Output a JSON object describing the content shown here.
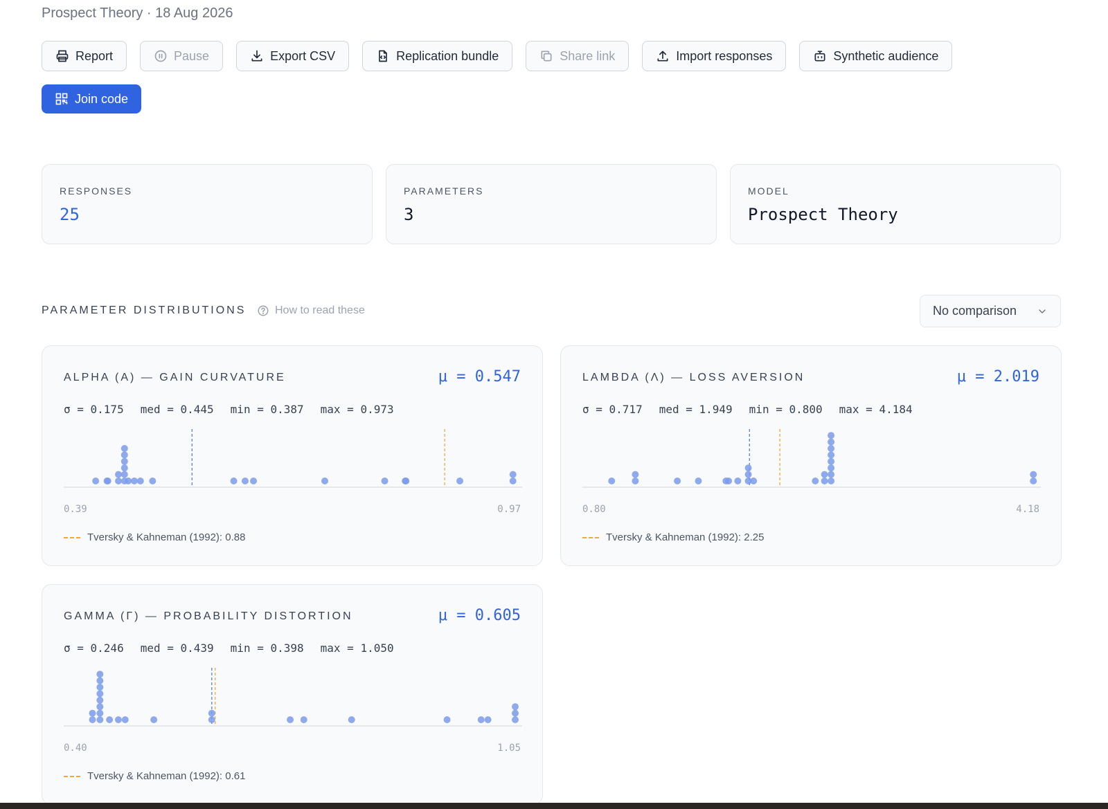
{
  "header": {
    "subtitle": "Prospect Theory · 18 Aug 2026"
  },
  "toolbar": {
    "buttons": [
      {
        "label": "Report",
        "icon": "printer-icon",
        "muted": false
      },
      {
        "label": "Pause",
        "icon": "pause-icon",
        "muted": true
      },
      {
        "label": "Export CSV",
        "icon": "download-icon",
        "muted": false
      },
      {
        "label": "Replication bundle",
        "icon": "file-code-icon",
        "muted": false
      },
      {
        "label": "Share link",
        "icon": "copy-icon",
        "muted": true
      },
      {
        "label": "Import responses",
        "icon": "upload-icon",
        "muted": false
      },
      {
        "label": "Synthetic audience",
        "icon": "bot-icon",
        "muted": false
      }
    ],
    "primary": {
      "label": "Join code",
      "icon": "qr-code-icon"
    }
  },
  "stats": [
    {
      "label": "RESPONSES",
      "value": "25"
    },
    {
      "label": "PARAMETERS",
      "value": "3"
    },
    {
      "label": "MODEL",
      "value": "Prospect Theory"
    }
  ],
  "section": {
    "title": "PARAMETER DISTRIBUTIONS",
    "help": "How to read these",
    "comparison": "No comparison"
  },
  "colors": {
    "accent": "#2f63e0",
    "dot": "#7b9bea",
    "reference": "#f2a93b"
  },
  "chart_data": [
    {
      "type": "scatter",
      "title": "ALPHA (Α) — GAIN CURVATURE",
      "mu_label": "μ = 0.547",
      "sigma": "σ = 0.175",
      "median": "med = 0.445",
      "min": "min = 0.387",
      "max": "max = 0.973",
      "x_min_label": "0.39",
      "x_max_label": "0.97",
      "xlim": [
        0.387,
        0.973
      ],
      "mean": 0.547,
      "reference": 0.88,
      "reference_label": "Tversky & Kahneman (1992): 0.88",
      "values": [
        0.42,
        0.435,
        0.436,
        0.45,
        0.45,
        0.458,
        0.458,
        0.458,
        0.458,
        0.458,
        0.458,
        0.463,
        0.471,
        0.479,
        0.495,
        0.602,
        0.617,
        0.628,
        0.722,
        0.801,
        0.828,
        0.829,
        0.9,
        0.97,
        0.97
      ],
      "chart_type_note": "dot-stacked strip plot"
    },
    {
      "type": "scatter",
      "title": "LAMBDA (Λ) — LOSS AVERSION",
      "mu_label": "μ = 2.019",
      "sigma": "σ = 0.717",
      "median": "med = 1.949",
      "min": "min = 0.800",
      "max": "max = 4.184",
      "x_min_label": "0.80",
      "x_max_label": "4.18",
      "xlim": [
        0.8,
        4.184
      ],
      "mean": 2.019,
      "reference": 2.25,
      "reference_label": "Tversky & Kahneman (1992): 2.25",
      "values": [
        0.97,
        1.15,
        1.15,
        1.47,
        1.63,
        1.84,
        1.86,
        1.93,
        2.01,
        2.01,
        2.01,
        2.05,
        2.52,
        2.59,
        2.59,
        2.64,
        2.64,
        2.64,
        2.64,
        2.64,
        2.64,
        2.64,
        2.64,
        4.18,
        4.18
      ],
      "chart_type_note": "dot-stacked strip plot"
    },
    {
      "type": "scatter",
      "title": "GAMMA (Γ) — PROBABILITY DISTORTION",
      "mu_label": "μ = 0.605",
      "sigma": "σ = 0.246",
      "median": "med = 0.439",
      "min": "min = 0.398",
      "max": "max = 1.050",
      "x_min_label": "0.40",
      "x_max_label": "1.05",
      "xlim": [
        0.398,
        1.05
      ],
      "mean": 0.605,
      "reference": 0.61,
      "reference_label": "Tversky & Kahneman (1992): 0.61",
      "values": [
        0.43,
        0.43,
        0.441,
        0.441,
        0.441,
        0.441,
        0.441,
        0.441,
        0.441,
        0.441,
        0.455,
        0.468,
        0.478,
        0.52,
        0.605,
        0.605,
        0.72,
        0.74,
        0.81,
        0.95,
        1.0,
        1.01,
        1.05,
        1.05,
        1.05
      ],
      "chart_type_note": "dot-stacked strip plot"
    }
  ]
}
